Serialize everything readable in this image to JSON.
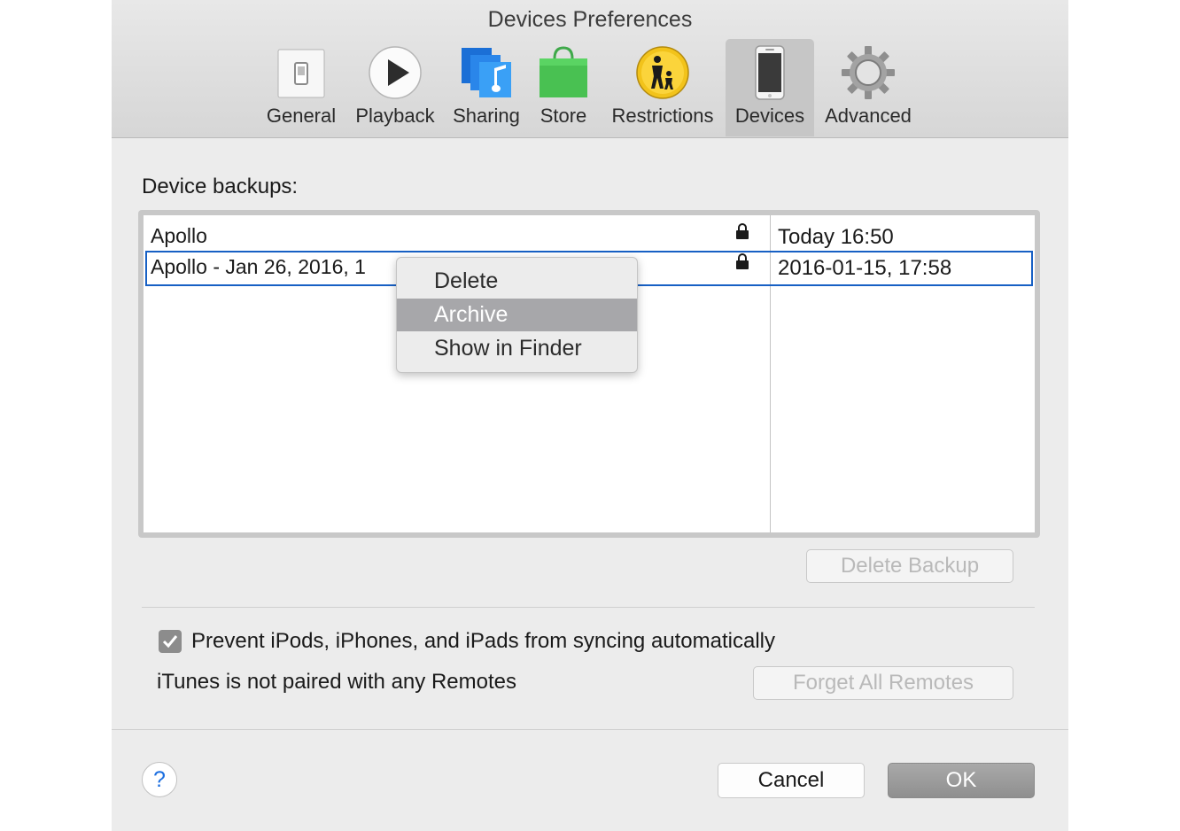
{
  "window": {
    "title": "Devices Preferences"
  },
  "toolbar": {
    "tabs": [
      {
        "label": "General",
        "icon": "general-switch-icon"
      },
      {
        "label": "Playback",
        "icon": "play-icon"
      },
      {
        "label": "Sharing",
        "icon": "sharing-music-icon"
      },
      {
        "label": "Store",
        "icon": "shopping-bag-icon"
      },
      {
        "label": "Restrictions",
        "icon": "parental-restrictions-icon"
      },
      {
        "label": "Devices",
        "icon": "iphone-icon",
        "selected": true
      },
      {
        "label": "Advanced",
        "icon": "gear-icon"
      }
    ]
  },
  "backups": {
    "label": "Device backups:",
    "rows": [
      {
        "name": "Apollo",
        "date": "Today 16:50",
        "locked": true,
        "selected": false
      },
      {
        "name": "Apollo - Jan 26, 2016, 1",
        "date": "2016-01-15, 17:58",
        "locked": true,
        "selected": true
      }
    ],
    "delete_button": "Delete Backup"
  },
  "context_menu": {
    "items": [
      {
        "label": "Delete",
        "highlighted": false
      },
      {
        "label": "Archive",
        "highlighted": true
      },
      {
        "label": "Show in Finder",
        "highlighted": false
      }
    ]
  },
  "options": {
    "prevent_sync_label": "Prevent iPods, iPhones, and iPads from syncing automatically",
    "prevent_sync_checked": true,
    "remotes_text": "iTunes is not paired with any Remotes",
    "forget_remotes_button": "Forget All Remotes"
  },
  "footer": {
    "help_label": "?",
    "cancel_label": "Cancel",
    "ok_label": "OK"
  },
  "colors": {
    "selection_border": "#1760c4",
    "menu_highlight": "#a7a7aa",
    "help_accent": "#1c6fe0"
  }
}
